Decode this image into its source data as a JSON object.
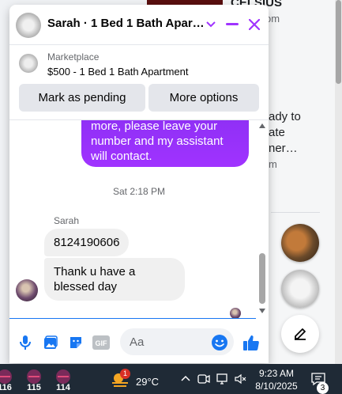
{
  "background": {
    "title_fragment": "CELSIUS",
    "fragment_om": "om",
    "fragment_text": "ady to\nate\nner…",
    "fragment_m": "m"
  },
  "chat": {
    "title": "Sarah · 1 Bed 1 Bath Apart...",
    "listing": {
      "source": "Marketplace",
      "title": "$500 - 1 Bed 1 Bath Apartment"
    },
    "actions": {
      "mark_pending": "Mark as pending",
      "more_options": "More options"
    },
    "outgoing_message": "more, please leave your\nnumber and my assistant\nwill contact.",
    "timestamp": "Sat 2:18 PM",
    "sender_name": "Sarah",
    "incoming_messages": [
      "8124190606",
      "Thank u have a blessed day"
    ],
    "composer": {
      "placeholder": "Aa"
    },
    "colors": {
      "accent": "#a033ff",
      "primary_blue": "#1877f2"
    }
  },
  "taskbar": {
    "badges": [
      "116",
      "115",
      "114"
    ],
    "weather_alert": "1",
    "temperature": "29°C",
    "time": "9:23 AM",
    "date": "8/10/2025",
    "notification_count": "3"
  }
}
